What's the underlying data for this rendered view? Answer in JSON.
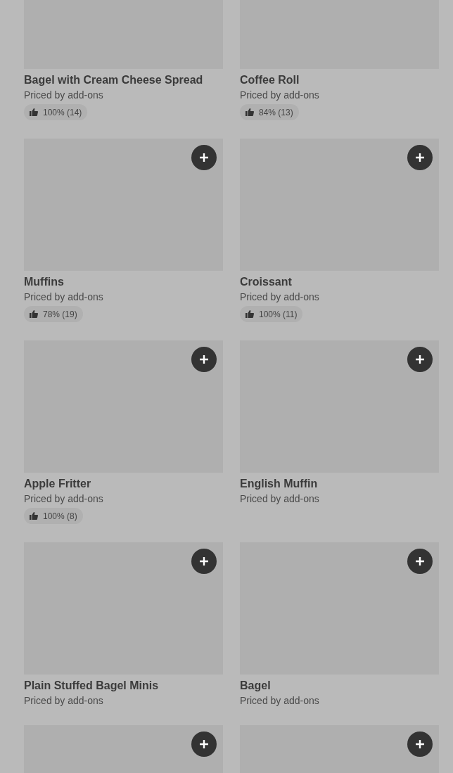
{
  "items": [
    {
      "title": "Bagel with Cream Cheese Spread",
      "price": "Priced by add-ons",
      "rating": "100% (14)"
    },
    {
      "title": "Coffee Roll",
      "price": "Priced by add-ons",
      "rating": "84% (13)"
    },
    {
      "title": "Muffins",
      "price": "Priced by add-ons",
      "rating": "78% (19)",
      "add_button": true
    },
    {
      "title": "Croissant",
      "price": "Priced by add-ons",
      "rating": "100% (11)",
      "add_button": true
    },
    {
      "title": "Apple Fritter",
      "price": "Priced by add-ons",
      "rating": "100% (8)",
      "add_button": true
    },
    {
      "title": "English Muffin",
      "price": "Priced by add-ons",
      "add_button": true
    },
    {
      "title": "Plain Stuffed Bagel Minis",
      "price": "Priced by add-ons",
      "add_button": true
    },
    {
      "title": "Bagel",
      "price": "Priced by add-ons",
      "add_button": true
    },
    {
      "add_button": true
    },
    {
      "add_button": true
    }
  ]
}
